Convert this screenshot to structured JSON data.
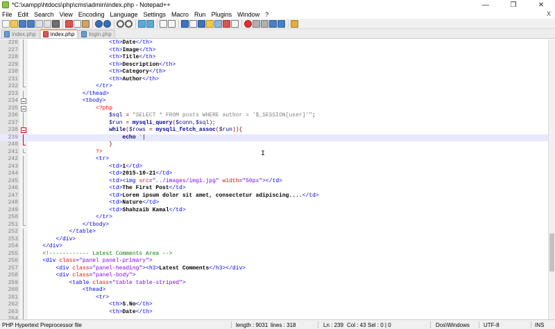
{
  "window": {
    "title": "*C:\\xampp\\htdocs\\php\\cms\\admin\\index.php - Notepad++",
    "minimize": "—",
    "maximize": "❐",
    "close": "✕"
  },
  "menu": {
    "items": [
      "File",
      "Edit",
      "Search",
      "View",
      "Encoding",
      "Language",
      "Settings",
      "Macro",
      "Run",
      "Plugins",
      "Window",
      "?"
    ],
    "close": "X"
  },
  "tabs": [
    {
      "label": "index.php",
      "active": false
    },
    {
      "label": "index.php",
      "active": true
    },
    {
      "label": "login.php",
      "active": false
    }
  ],
  "editor": {
    "current_line": 239,
    "lines": [
      {
        "n": "226",
        "fold": "v"
      },
      {
        "n": "227",
        "fold": "v"
      },
      {
        "n": "228",
        "fold": "v"
      },
      {
        "n": "229",
        "fold": "v"
      },
      {
        "n": "230",
        "fold": "v"
      },
      {
        "n": "231",
        "fold": "v"
      },
      {
        "n": "232",
        "fold": "e"
      },
      {
        "n": "233",
        "fold": "v"
      },
      {
        "n": "234",
        "fold": "box"
      },
      {
        "n": "235",
        "fold": "box"
      },
      {
        "n": "236",
        "fold": "v"
      },
      {
        "n": "237",
        "fold": "v"
      },
      {
        "n": "238",
        "fold": "boxred"
      },
      {
        "n": "239",
        "fold": "redv"
      },
      {
        "n": "240",
        "fold": "rede"
      },
      {
        "n": "241",
        "fold": "e"
      },
      {
        "n": "242",
        "fold": "v"
      },
      {
        "n": "243",
        "fold": "v"
      },
      {
        "n": "244",
        "fold": "v"
      },
      {
        "n": "245",
        "fold": "v"
      },
      {
        "n": "246",
        "fold": "v"
      },
      {
        "n": "247",
        "fold": "v"
      },
      {
        "n": "248",
        "fold": "v"
      },
      {
        "n": "249",
        "fold": "v"
      },
      {
        "n": "250",
        "fold": "v"
      },
      {
        "n": "251",
        "fold": "e"
      },
      {
        "n": "252",
        "fold": "v"
      },
      {
        "n": "253",
        "fold": "v"
      },
      {
        "n": "254",
        "fold": "v"
      },
      {
        "n": "255",
        "fold": "v"
      },
      {
        "n": "256",
        "fold": "v"
      },
      {
        "n": "257",
        "fold": "v"
      },
      {
        "n": "258",
        "fold": "v"
      },
      {
        "n": "259",
        "fold": "v"
      },
      {
        "n": "260",
        "fold": "v"
      },
      {
        "n": "261",
        "fold": "v"
      },
      {
        "n": "262",
        "fold": "v"
      },
      {
        "n": "263",
        "fold": "v"
      },
      {
        "n": "264",
        "fold": "v"
      }
    ]
  },
  "status": {
    "language": "PHP Hypertext Preprocessor file",
    "length": "length : 9031",
    "lines": "lines : 318",
    "position": "Ln : 239",
    "column": "Col : 43",
    "selection": "Sel : 0 | 0",
    "eol": "Dos\\Windows",
    "encoding": "UTF-8",
    "mode": "INS"
  },
  "colors": {
    "gutter": "#e4e4e4",
    "current_line": "#e8e8ff",
    "tag": "#0000ff",
    "attribute": "#ff0000",
    "string": "#8000ff",
    "comment": "#008000",
    "active_tab_accent": "#f7a35c"
  }
}
